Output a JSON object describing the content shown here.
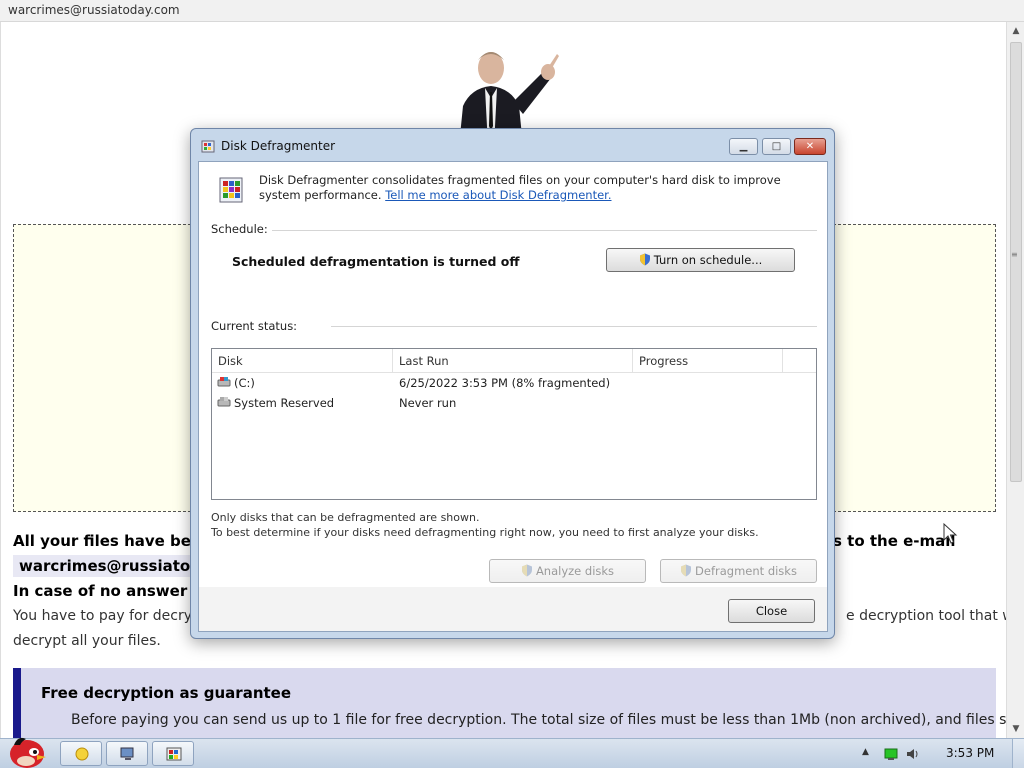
{
  "browser": {
    "address": "warcrimes@russiatoday.com"
  },
  "background": {
    "line1_left": "All your files have been",
    "line1_right": "s to the e-mail",
    "email": "warcrimes@russiatoday",
    "line2": "In case of no answer in",
    "line3_left": "You have to pay for decrypt",
    "line3_right": "e decryption tool that will",
    "line4": "decrypt all your files.",
    "guarantee_title": "Free decryption as guarantee",
    "guarantee_text": "Before paying you can send us up to 1 file for free decryption. The total size of files must be less than 1Mb (non archived), and files should"
  },
  "dialog": {
    "title": "Disk Defragmenter",
    "intro": "Disk Defragmenter consolidates fragmented files on your computer's hard disk to improve system performance.",
    "intro_link": "Tell me more about Disk Defragmenter.",
    "schedule_label": "Schedule:",
    "schedule_status": "Scheduled defragmentation is turned off",
    "turn_on_schedule": "Turn on schedule...",
    "current_status_label": "Current status:",
    "columns": {
      "disk": "Disk",
      "last_run": "Last Run",
      "progress": "Progress"
    },
    "disks": [
      {
        "name": "(C:)",
        "last_run": "6/25/2022 3:53 PM (8% fragmented)",
        "progress": ""
      },
      {
        "name": "System Reserved",
        "last_run": "Never run",
        "progress": ""
      }
    ],
    "note1": "Only disks that can be defragmented are shown.",
    "note2": "To best determine if your disks need defragmenting right now, you need to first analyze your disks.",
    "analyze_disks": "Analyze disks",
    "defragment_disks": "Defragment disks",
    "close": "Close"
  },
  "taskbar": {
    "clock": "3:53 PM"
  },
  "colors": {
    "guarantee_bar": "#1a1a8c",
    "guarantee_bg": "#d9d9ee",
    "yellow_box": "#ffffee",
    "link": "#1a58b8"
  }
}
